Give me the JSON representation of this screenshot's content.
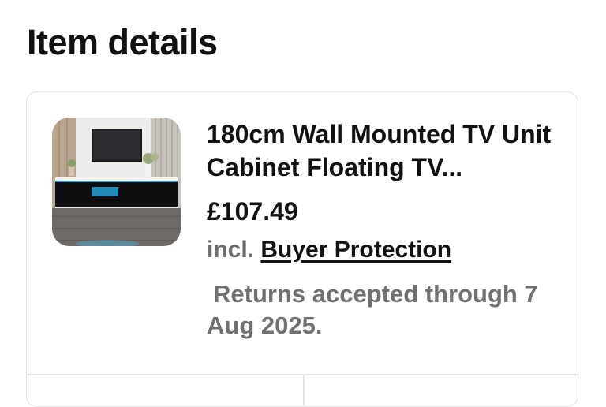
{
  "page": {
    "title": "Item details"
  },
  "item": {
    "thumbnail_alt": "TV unit thumbnail",
    "title": "180cm Wall Mounted TV Unit Cabinet Floating TV...",
    "price": "£107.49",
    "protection_prefix": "incl.",
    "protection_link": "Buyer Protection",
    "returns_text": "Returns accepted through 7 Aug 2025."
  },
  "colors": {
    "text_primary": "#111111",
    "text_secondary": "#6b6b6b",
    "border": "#e3e3e3",
    "led_accent": "#38c6ff"
  }
}
